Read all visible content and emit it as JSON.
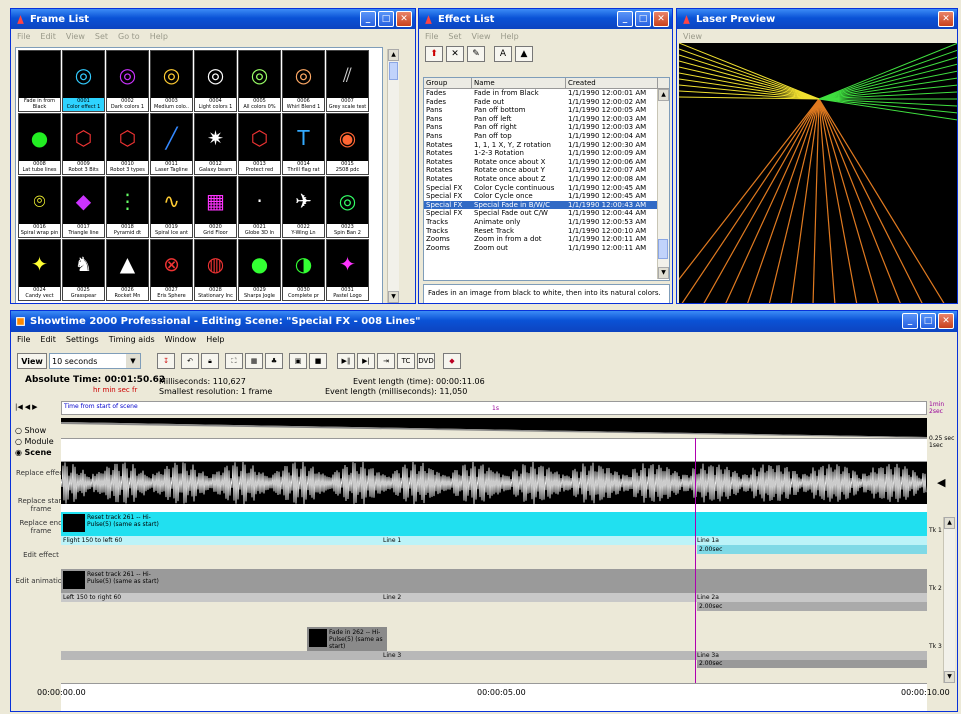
{
  "frame_list": {
    "title": "Frame List",
    "menu": [
      "File",
      "Edit",
      "View",
      "Set",
      "Go to",
      "Help"
    ],
    "frames": [
      {
        "n": "",
        "label": "Fade in from Black",
        "icon": "",
        "color": "#000"
      },
      {
        "n": "0001",
        "label": "Color effect 1",
        "icon": "◎",
        "color": "#3cf",
        "sel": true
      },
      {
        "n": "0002",
        "label": "Dark colors 1",
        "icon": "◎",
        "color": "#c3f"
      },
      {
        "n": "0003",
        "label": "Medium colo..",
        "icon": "◎",
        "color": "#fc3"
      },
      {
        "n": "0004",
        "label": "Light colors 1",
        "icon": "◎",
        "color": "#fff"
      },
      {
        "n": "0005",
        "label": "All colors 0%",
        "icon": "◎",
        "color": "#9f6"
      },
      {
        "n": "0006",
        "label": "Whirl Blend 1",
        "icon": "◎",
        "color": "#fa6"
      },
      {
        "n": "0007",
        "label": "Grey scale test",
        "icon": "⫽",
        "color": "#ccc"
      },
      {
        "n": "0008",
        "label": "Lat tube lines",
        "icon": "●",
        "color": "#2e2"
      },
      {
        "n": "0009",
        "label": "Robot 3 Bits",
        "icon": "⬡",
        "color": "#e33"
      },
      {
        "n": "0010",
        "label": "Robot 3 types",
        "icon": "⬡",
        "color": "#e33"
      },
      {
        "n": "0011",
        "label": "Laser Tagline",
        "icon": "╱",
        "color": "#38f"
      },
      {
        "n": "0012",
        "label": "Galaxy beam",
        "icon": "✷",
        "color": "#fff"
      },
      {
        "n": "0013",
        "label": "Protect red",
        "icon": "⬡",
        "color": "#e33"
      },
      {
        "n": "0014",
        "label": "Thrill flag rat",
        "icon": "T",
        "color": "#3af"
      },
      {
        "n": "0015",
        "label": "2508 pdc",
        "icon": "◉",
        "color": "#f63"
      },
      {
        "n": "0016",
        "label": "Spiral wrap pin",
        "icon": "⌾",
        "color": "#ff3"
      },
      {
        "n": "0017",
        "label": "Triangle line",
        "icon": "◆",
        "color": "#c3f"
      },
      {
        "n": "0018",
        "label": "Pyramid dt",
        "icon": "⋮",
        "color": "#6f6"
      },
      {
        "n": "0019",
        "label": "Spiral Ice ant",
        "icon": "∿",
        "color": "#fc3"
      },
      {
        "n": "0020",
        "label": "Grid Floor",
        "icon": "▦",
        "color": "#f3f"
      },
      {
        "n": "0021",
        "label": "Globe 3D ln",
        "icon": "·",
        "color": "#fff"
      },
      {
        "n": "0022",
        "label": "Y-Wing Ln",
        "icon": "✈",
        "color": "#fff"
      },
      {
        "n": "0023",
        "label": "Spin Ban 2",
        "icon": "◎",
        "color": "#3f6"
      },
      {
        "n": "0024",
        "label": "Candy vect",
        "icon": "✦",
        "color": "#ff3"
      },
      {
        "n": "0025",
        "label": "Grasspear",
        "icon": "♞",
        "color": "#fff"
      },
      {
        "n": "0026",
        "label": "Rocket Mn",
        "icon": "▲",
        "color": "#fff"
      },
      {
        "n": "0027",
        "label": "Eris Sphere",
        "icon": "⊗",
        "color": "#e33"
      },
      {
        "n": "0028",
        "label": "Stationary Inc",
        "icon": "◍",
        "color": "#e33"
      },
      {
        "n": "0029",
        "label": "Sharps Jogle",
        "icon": "●",
        "color": "#3f3"
      },
      {
        "n": "0030",
        "label": "Complete pr",
        "icon": "◑",
        "color": "#3f3"
      },
      {
        "n": "0031",
        "label": "Pastel Logo",
        "icon": "✦",
        "color": "#f3f"
      }
    ]
  },
  "effect_list": {
    "title": "Effect List",
    "menu": [
      "File",
      "Set",
      "View",
      "Help"
    ],
    "columns": [
      "Group",
      "Name",
      "Created"
    ],
    "rows": [
      [
        "Fades",
        "Fade in from Black",
        "1/1/1990 12:00:01 AM"
      ],
      [
        "Fades",
        "Fade out",
        "1/1/1990 12:00:02 AM"
      ],
      [
        "Pans",
        "Pan off bottom",
        "1/1/1990 12:00:05 AM"
      ],
      [
        "Pans",
        "Pan off left",
        "1/1/1990 12:00:03 AM"
      ],
      [
        "Pans",
        "Pan off right",
        "1/1/1990 12:00:03 AM"
      ],
      [
        "Pans",
        "Pan off top",
        "1/1/1990 12:00:04 AM"
      ],
      [
        "Rotates",
        "1, 1, 1 X, Y, Z rotation",
        "1/1/1990 12:00:30 AM"
      ],
      [
        "Rotates",
        "1-2-3 Rotation",
        "1/1/1990 12:00:09 AM"
      ],
      [
        "Rotates",
        "Rotate once about X",
        "1/1/1990 12:00:06 AM"
      ],
      [
        "Rotates",
        "Rotate once about Y",
        "1/1/1990 12:00:07 AM"
      ],
      [
        "Rotates",
        "Rotate once about Z",
        "1/1/1990 12:00:08 AM"
      ],
      [
        "Special FX",
        "Color Cycle continuous",
        "1/1/1990 12:00:45 AM"
      ],
      [
        "Special FX",
        "Color Cycle once",
        "1/1/1990 12:00:45 AM"
      ],
      [
        "Special FX",
        "Special Fade in B/W/C",
        "1/1/1990 12:00:43 AM"
      ],
      [
        "Special FX",
        "Special Fade out C/W",
        "1/1/1990 12:00:44 AM"
      ],
      [
        "Tracks",
        "Animate only",
        "1/1/1990 12:00:53 AM"
      ],
      [
        "Tracks",
        "Reset Track",
        "1/1/1990 12:00:10 AM"
      ],
      [
        "Zooms",
        "Zoom in from a dot",
        "1/1/1990 12:00:11 AM"
      ],
      [
        "Zooms",
        "Zoom out",
        "1/1/1990 12:00:11 AM"
      ]
    ],
    "description": "Fades in an image from black to white, then into its natural colors."
  },
  "laser_preview": {
    "title": "Laser Preview",
    "menu": [
      "View"
    ]
  },
  "showtime": {
    "title": "Showtime 2000 Professional - Editing Scene: \"Special FX - 008 Lines\"",
    "menu": [
      "File",
      "Edit",
      "Settings",
      "Timing aids",
      "Window",
      "Help"
    ],
    "view_label": "View",
    "view_value": "10 seconds",
    "abs_time_label": "Absolute Time:",
    "abs_time": "00:01:50.62",
    "hms": "hr min sec fr",
    "ms_label": "Milliseconds: 110,627",
    "smallest": "Smallest resolution: 1 frame",
    "event_len": "Event length (time): 00:00:11.06",
    "event_ms": "Event length (milliseconds): 11,050",
    "ruler_label": "Time from start of scene",
    "ruler_mid": "1s",
    "ruler_right": "1min 2sec",
    "radios": [
      "Show",
      "Module",
      "Scene"
    ],
    "radio_checked": 2,
    "side_buttons": [
      "Replace effect",
      "Replace start frame",
      "Replace end frame",
      "Edit effect",
      "Edit animation"
    ],
    "scale_top": "0.25 sec 1sec",
    "t1_header": "Reset track 261 -- Hi-Pulse(5) (same as start)",
    "t1_line": "Flight 150 to left 60",
    "t1_mid": "Line 1",
    "t1_end": "Line 1a",
    "t1_end2": "2.00sec",
    "t2_header": "Reset track 261 -- Hi-Pulse(5) (same as start)",
    "t2_line": "Left 150 to right 60",
    "t2_mid": "Line 2",
    "t2_end": "Line 2a",
    "t2_end2": "2.00sec",
    "t3_header": "Fade in 262 -- Hi-Pulse(5) (same as start)",
    "t3_mid": "Line 3",
    "t3_end": "Line 3a",
    "t3_end2": "2.00sec",
    "tk1": "Tk 1 2ch",
    "tk2": "Tk 2 2ch",
    "tk3": "Tk 3 2ch",
    "times": [
      "00:00:00.00",
      "00:00:05.00",
      "00:00:10.00"
    ]
  }
}
